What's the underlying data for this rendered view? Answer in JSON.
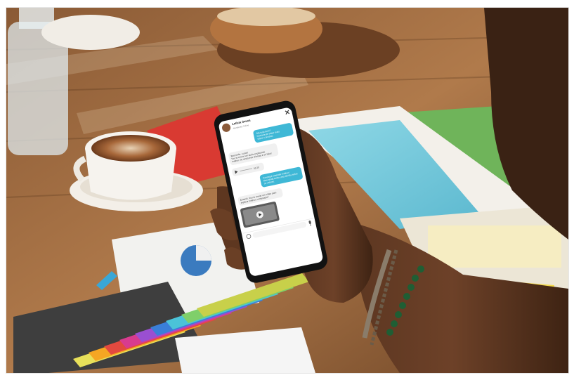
{
  "chat": {
    "contact_name": "Letícia Souza",
    "contact_status": "Atendente Online",
    "messages": [
      {
        "from": "user",
        "lines": [
          "Olá tudo bem?",
          "Gostaria de saber mais",
          "sobre o produto."
        ]
      },
      {
        "from": "agent",
        "lines": [
          "Boa tarde, Lucas!",
          "Vou te enviar um áudio explicando",
          "melhor. Se ainda tiver dúvidas é só falar!"
        ]
      },
      {
        "from": "agent_audio",
        "duration": "01:20"
      },
      {
        "from": "user",
        "lines": [
          "Consegui entender melhor!",
          "Mas ainda tenho uma dúvida sobre",
          "os valores."
        ]
      },
      {
        "from": "agent",
        "lines": [
          "Entendi. Vou te enviar um vídeo para",
          "explicar melhor, combinado?"
        ]
      },
      {
        "from": "agent_video"
      }
    ]
  },
  "icons": [
    "close-icon",
    "play-icon",
    "emoji-icon",
    "microphone-icon"
  ],
  "colors": {
    "accent_bubble": "#3fb8d6",
    "phone_body": "#121212",
    "sticky_tabs": [
      "#e8e05a",
      "#f5a623",
      "#e2493f",
      "#d83b8f",
      "#9a4fd1",
      "#3a7fd8",
      "#4bc3d8",
      "#7fcf6a",
      "#c8d04a"
    ]
  }
}
